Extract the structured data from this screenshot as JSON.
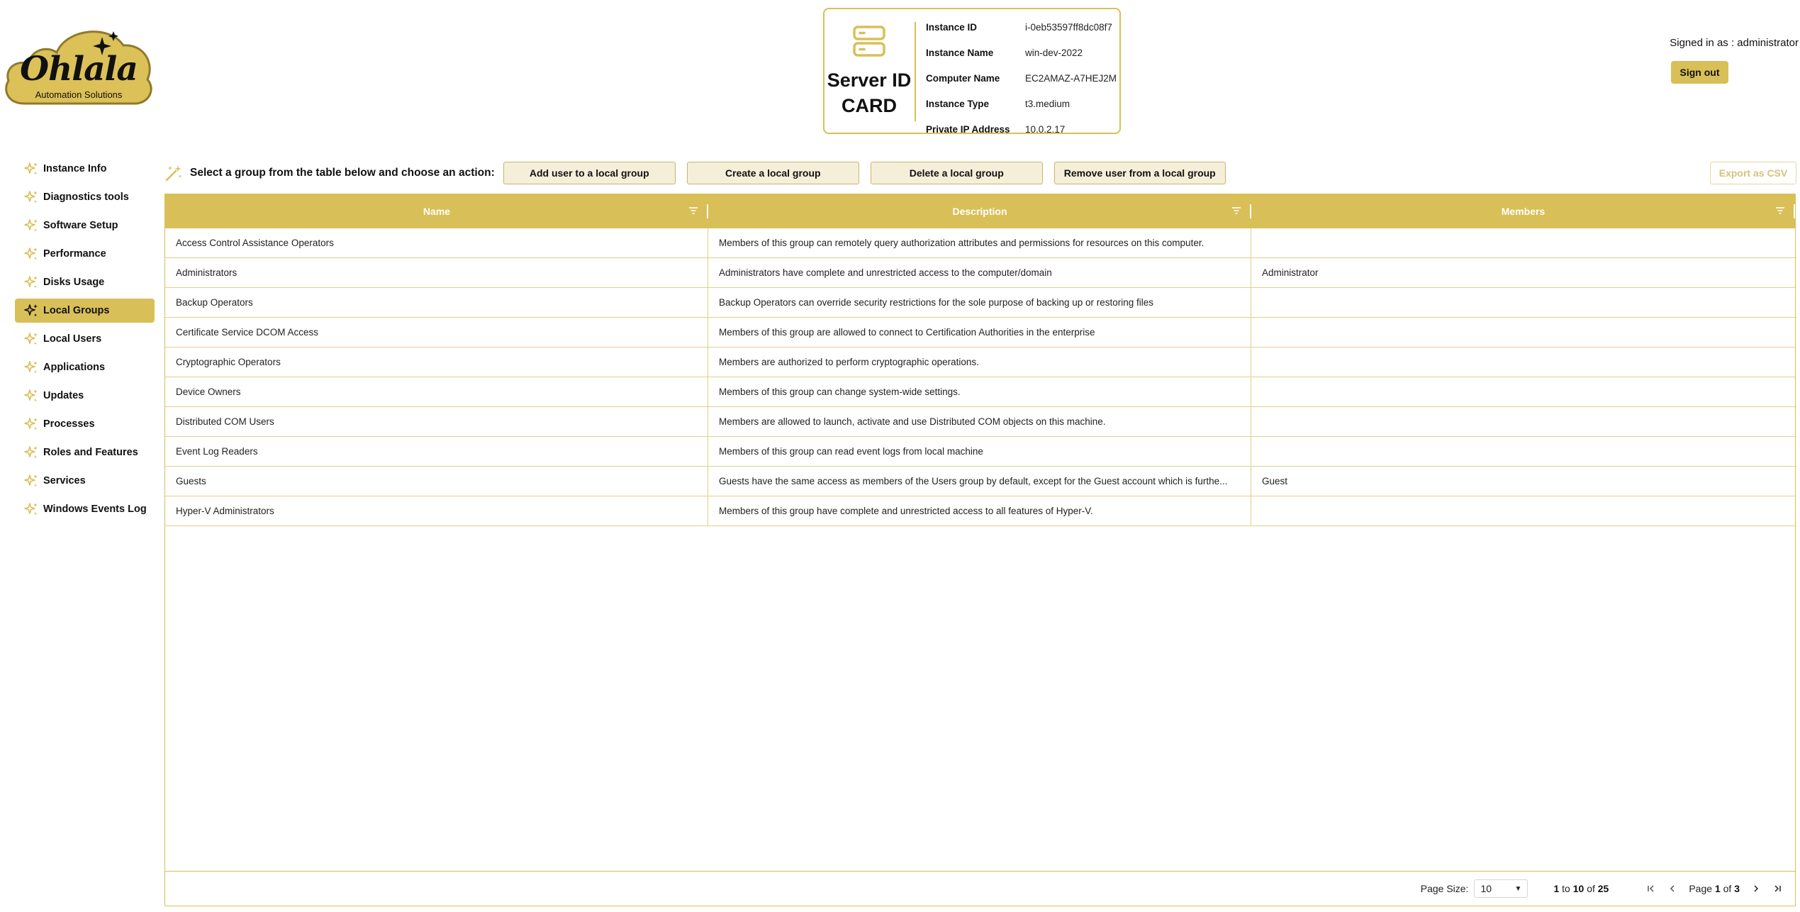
{
  "brand": {
    "name": "Ohlala",
    "tagline": "Automation Solutions",
    "accent_color": "#d9bf58"
  },
  "id_card": {
    "title_line1": "Server ID",
    "title_line2": "CARD",
    "icon": "server-icon",
    "fields": [
      {
        "label": "Instance ID",
        "value": "i-0eb53597ff8dc08f7"
      },
      {
        "label": "Instance Name",
        "value": "win-dev-2022"
      },
      {
        "label": "Computer Name",
        "value": "EC2AMAZ-A7HEJ2M"
      },
      {
        "label": "Instance Type",
        "value": "t3.medium"
      },
      {
        "label": "Private IP Address",
        "value": "10.0.2.17"
      }
    ]
  },
  "user": {
    "signed_in_text": "Signed in as : administrator",
    "sign_out_label": "Sign out"
  },
  "sidebar": {
    "item_icon": "sparkle-icon",
    "items": [
      {
        "label": "Instance Info",
        "active": false
      },
      {
        "label": "Diagnostics tools",
        "active": false
      },
      {
        "label": "Software Setup",
        "active": false
      },
      {
        "label": "Performance",
        "active": false
      },
      {
        "label": "Disks Usage",
        "active": false
      },
      {
        "label": "Local Groups",
        "active": true
      },
      {
        "label": "Local Users",
        "active": false
      },
      {
        "label": "Applications",
        "active": false
      },
      {
        "label": "Updates",
        "active": false
      },
      {
        "label": "Processes",
        "active": false
      },
      {
        "label": "Roles and Features",
        "active": false
      },
      {
        "label": "Services",
        "active": false
      },
      {
        "label": "Windows Events Log",
        "active": false
      }
    ]
  },
  "toolbar": {
    "prompt": "Select a group from the table below and choose an action:",
    "actions": [
      "Add user to a local group",
      "Create a local group",
      "Delete a local group",
      "Remove user from a local group"
    ],
    "export_label": "Export as CSV"
  },
  "grid": {
    "columns": [
      "Name",
      "Description",
      "Members"
    ],
    "rows": [
      [
        "Access Control Assistance Operators",
        "Members of this group can remotely query authorization attributes and permissions for resources on this computer.",
        ""
      ],
      [
        "Administrators",
        "Administrators have complete and unrestricted access to the computer/domain",
        "Administrator"
      ],
      [
        "Backup Operators",
        "Backup Operators can override security restrictions for the sole purpose of backing up or restoring files",
        ""
      ],
      [
        "Certificate Service DCOM Access",
        "Members of this group are allowed to connect to Certification Authorities in the enterprise",
        ""
      ],
      [
        "Cryptographic Operators",
        "Members are authorized to perform cryptographic operations.",
        ""
      ],
      [
        "Device Owners",
        "Members of this group can change system-wide settings.",
        ""
      ],
      [
        "Distributed COM Users",
        "Members are allowed to launch, activate and use Distributed COM objects on this machine.",
        ""
      ],
      [
        "Event Log Readers",
        "Members of this group can read event logs from local machine",
        ""
      ],
      [
        "Guests",
        "Guests have the same access as members of the Users group by default, except for the Guest account which is furthe...",
        "Guest"
      ],
      [
        "Hyper-V Administrators",
        "Members of this group have complete and unrestricted access to all features of Hyper-V.",
        ""
      ]
    ]
  },
  "pagination": {
    "page_size_label": "Page Size:",
    "page_size": "10",
    "range_from": "1",
    "range_to_word": "to",
    "range_to": "10",
    "of_word": "of",
    "total": "25",
    "page_word": "Page",
    "page": "1",
    "pages": "3"
  }
}
